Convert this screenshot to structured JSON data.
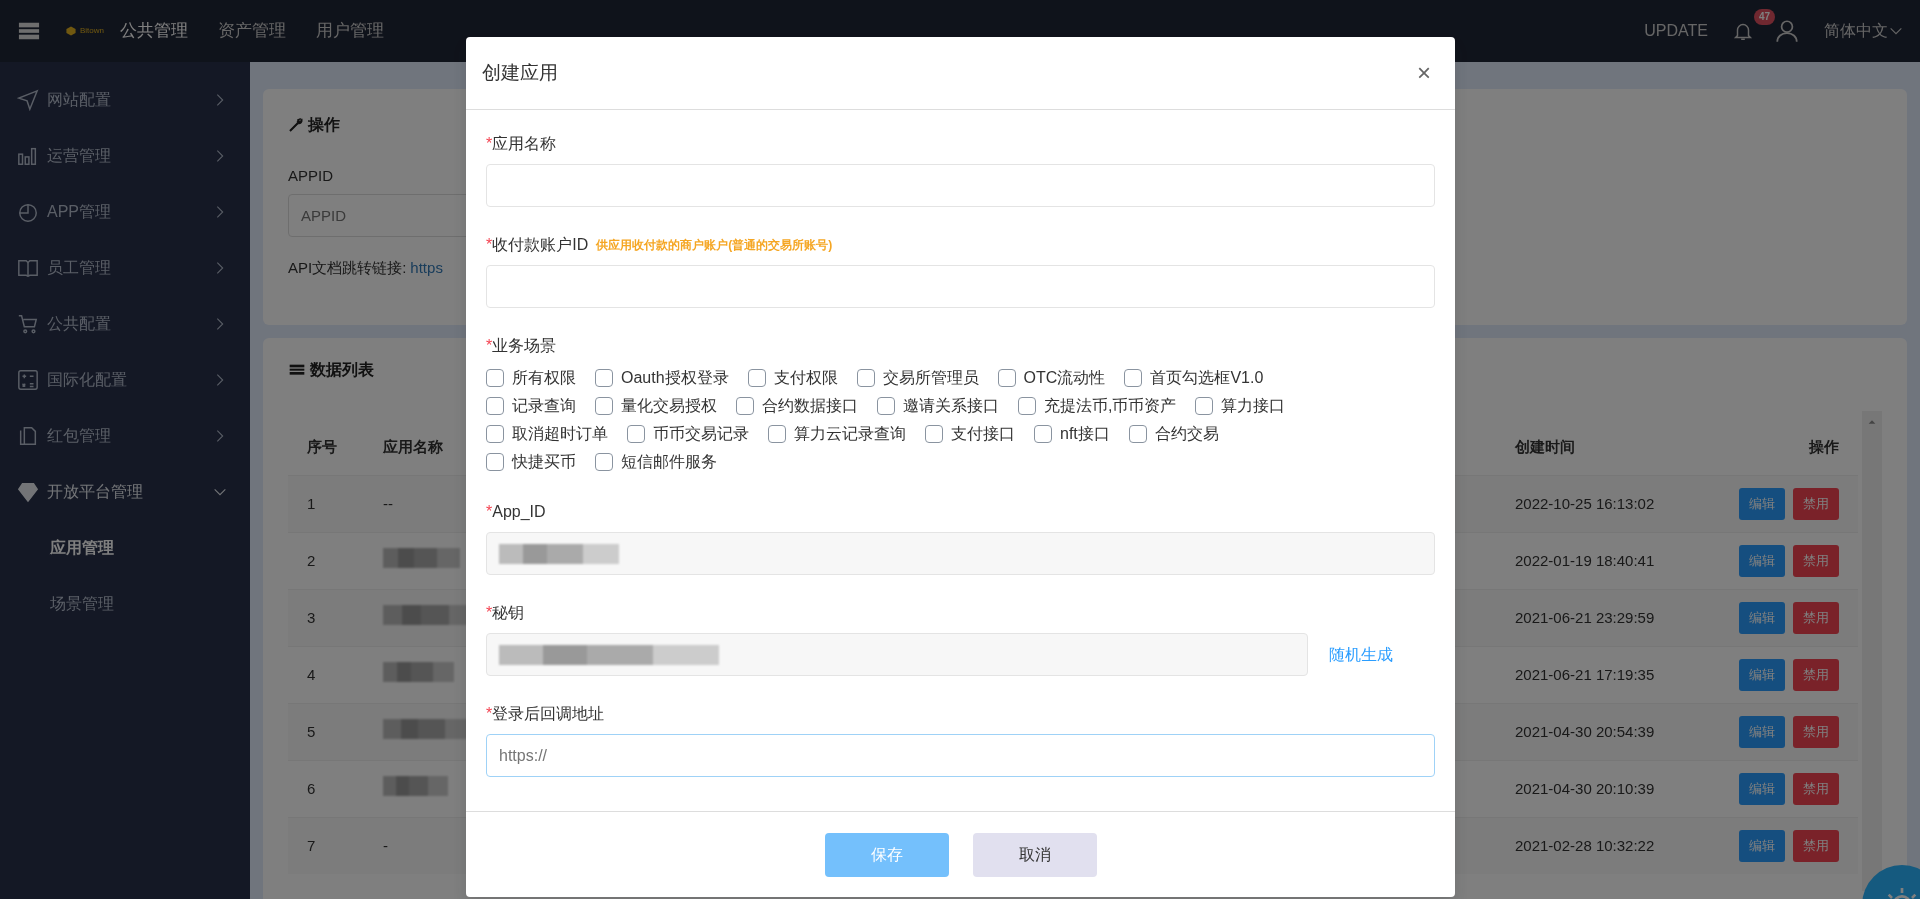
{
  "navbar": {
    "logo_text": "Bitown",
    "menu": [
      {
        "label": "公共管理",
        "selected": true
      },
      {
        "label": "资产管理",
        "selected": false
      },
      {
        "label": "用户管理",
        "selected": false
      }
    ],
    "update": "UPDATE",
    "notification_count": "47",
    "language": "简体中文"
  },
  "sidebar": {
    "items": [
      {
        "label": "网站配置",
        "expanded": false
      },
      {
        "label": "运营管理",
        "expanded": false
      },
      {
        "label": "APP管理",
        "expanded": false
      },
      {
        "label": "员工管理",
        "expanded": false
      },
      {
        "label": "公共配置",
        "expanded": false
      },
      {
        "label": "国际化配置",
        "expanded": false
      },
      {
        "label": "红包管理",
        "expanded": false
      },
      {
        "label": "开放平台管理",
        "expanded": true,
        "children": [
          {
            "label": "应用管理",
            "selected": true
          },
          {
            "label": "场景管理",
            "selected": false
          }
        ]
      }
    ]
  },
  "operation_card": {
    "title": "操作",
    "appid_label": "APPID",
    "appid_placeholder": "APPID",
    "doc_label": "API文档跳转链接:",
    "doc_link": "https"
  },
  "data_card": {
    "title": "数据列表",
    "table": {
      "columns": [
        "序号",
        "应用名称",
        "创建时间",
        "操作"
      ],
      "rows": [
        {
          "index": "1",
          "name": "--",
          "created": "2022-10-25 16:13:02",
          "actions": [
            "编辑",
            "禁用"
          ]
        },
        {
          "index": "2",
          "name_redacted": true,
          "created": "2022-01-19 18:40:41",
          "actions": [
            "编辑",
            "禁用"
          ]
        },
        {
          "index": "3",
          "name_redacted": true,
          "created": "2021-06-21 23:29:59",
          "actions": [
            "编辑",
            "禁用"
          ]
        },
        {
          "index": "4",
          "name_redacted": true,
          "created": "2021-06-21 17:19:35",
          "actions": [
            "编辑",
            "禁用"
          ]
        },
        {
          "index": "5",
          "name_redacted": true,
          "created": "2021-04-30 20:54:39",
          "actions": [
            "编辑",
            "禁用"
          ]
        },
        {
          "index": "6",
          "name_redacted": true,
          "created": "2021-04-30 20:10:39",
          "actions": [
            "编辑",
            "禁用"
          ]
        },
        {
          "index": "7",
          "name": "-",
          "created": "2021-02-28 10:32:22",
          "actions": [
            "编辑",
            "禁用"
          ]
        }
      ]
    }
  },
  "modal": {
    "title": "创建应用",
    "close": "×",
    "fields": [
      {
        "kind": "text",
        "mark": "*",
        "label": "应用名称"
      },
      {
        "kind": "text",
        "mark": "*",
        "label": "收付款账户ID",
        "hint": "供应用收付款的商户账户(普通的交易所账号)"
      },
      {
        "kind": "checkboxes",
        "mark": "*",
        "label": "业务场景",
        "option_rows": [
          [
            {
              "label": "所有权限",
              "checked": false
            },
            {
              "label": "Oauth授权登录",
              "checked": false
            },
            {
              "label": "支付权限",
              "checked": false
            },
            {
              "label": "交易所管理员",
              "checked": false
            },
            {
              "label": "OTC流动性",
              "checked": false
            },
            {
              "label": "首页勾选框V1.0",
              "checked": false
            }
          ],
          [
            {
              "label": "记录查询",
              "checked": false
            },
            {
              "label": "量化交易授权",
              "checked": false
            },
            {
              "label": "合约数据接口",
              "checked": false
            },
            {
              "label": "邀请关系接口",
              "checked": false
            },
            {
              "label": "充提法币,币币资产",
              "checked": false
            },
            {
              "label": "算力接口",
              "checked": false
            }
          ],
          [
            {
              "label": "取消超时订单",
              "checked": false
            },
            {
              "label": "币币交易记录",
              "checked": false
            },
            {
              "label": "算力云记录查询",
              "checked": false
            },
            {
              "label": "支付接口",
              "checked": false
            },
            {
              "label": "nft接口",
              "checked": false
            },
            {
              "label": "合约交易",
              "checked": false
            }
          ],
          [
            {
              "label": "快捷买币",
              "checked": false
            },
            {
              "label": "短信邮件服务",
              "checked": false
            }
          ]
        ]
      },
      {
        "kind": "readonly",
        "mark": "*",
        "label": "App_ID",
        "redacted": true
      },
      {
        "kind": "readonly",
        "mark": "*",
        "label": "秘钥",
        "redacted": true,
        "action": "随机生成"
      },
      {
        "kind": "text",
        "mark": "*",
        "label": "登录后回调地址",
        "placeholder": "https://",
        "focused": true
      }
    ],
    "buttons": [
      {
        "label": "保存",
        "kind": "primary"
      },
      {
        "label": "取消",
        "kind": "secondary"
      }
    ]
  }
}
